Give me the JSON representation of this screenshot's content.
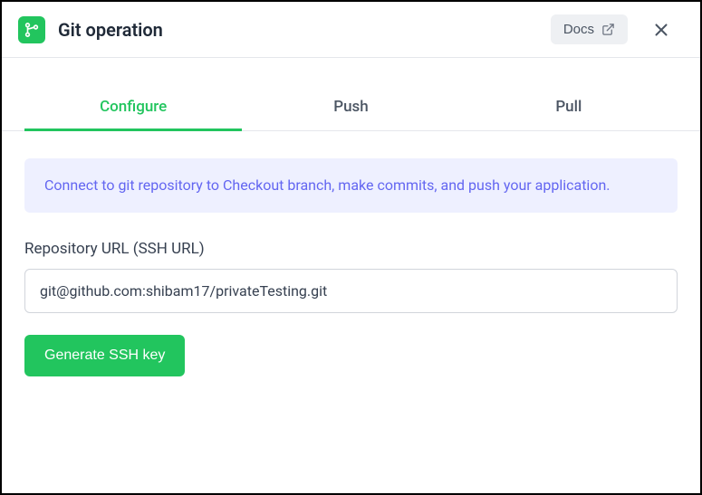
{
  "header": {
    "title": "Git operation",
    "docs_label": "Docs"
  },
  "tabs": [
    {
      "label": "Configure",
      "active": true
    },
    {
      "label": "Push",
      "active": false
    },
    {
      "label": "Pull",
      "active": false
    }
  ],
  "banner": {
    "text": "Connect to git repository to Checkout branch, make commits, and push your application."
  },
  "repo": {
    "label": "Repository URL (SSH URL)",
    "value": "git@github.com:shibam17/privateTesting.git"
  },
  "actions": {
    "generate_label": "Generate SSH key"
  }
}
